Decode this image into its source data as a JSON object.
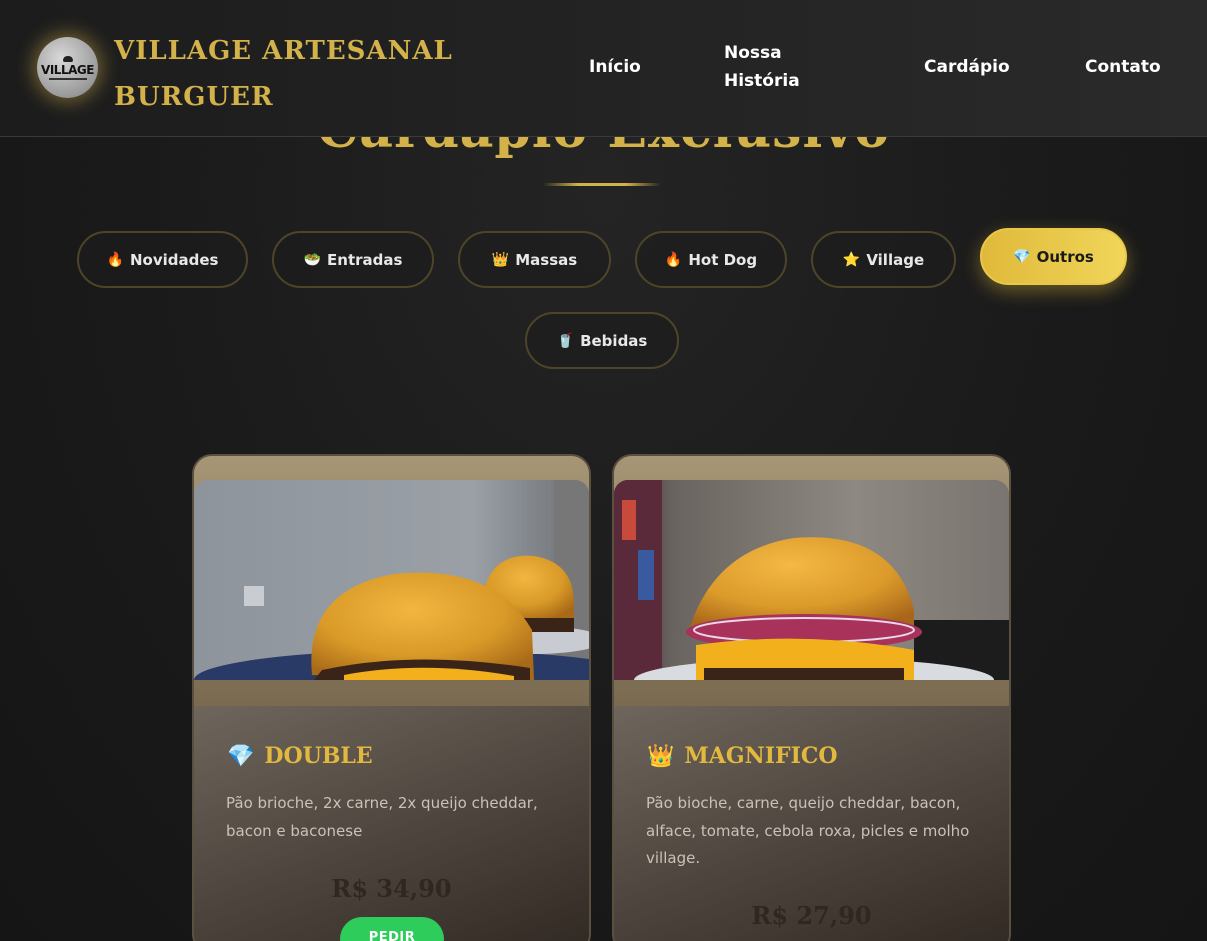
{
  "header": {
    "brand": "VILLAGE ARTESANAL BURGUER",
    "logo_text": "VILLAGE",
    "nav": [
      "Início",
      "Nossa História",
      "Cardápio",
      "Contato"
    ]
  },
  "section": {
    "title": "Cardápio Exclusivo"
  },
  "categories": [
    {
      "icon": "🔥",
      "label": "Novidades",
      "active": false
    },
    {
      "icon": "🥗",
      "label": "Entradas",
      "active": false
    },
    {
      "icon": "👑",
      "label": "Massas",
      "active": false
    },
    {
      "icon": "🔥",
      "label": "Hot Dog",
      "active": false
    },
    {
      "icon": "⭐",
      "label": "Village",
      "active": false
    },
    {
      "icon": "💎",
      "label": "Outros",
      "active": true
    },
    {
      "icon": "🥤",
      "label": "Bebidas",
      "active": false
    }
  ],
  "products": [
    {
      "icon": "💎",
      "name": "DOUBLE",
      "description": "Pão brioche, 2x carne, 2x queijo cheddar, bacon e baconese",
      "price": "R$ 34,90",
      "button": "PEDIR"
    },
    {
      "icon": "👑",
      "name": "MAGNIFICO",
      "description": "Pão bioche, carne, queijo cheddar, bacon, alface, tomate, cebola roxa, picles e molho village.",
      "price": "R$ 27,90"
    }
  ],
  "colors": {
    "accent": "#d4b24a",
    "active_chip": "#e8c84a",
    "order_button": "#2ecc5a",
    "background": "#1a1a1a"
  }
}
